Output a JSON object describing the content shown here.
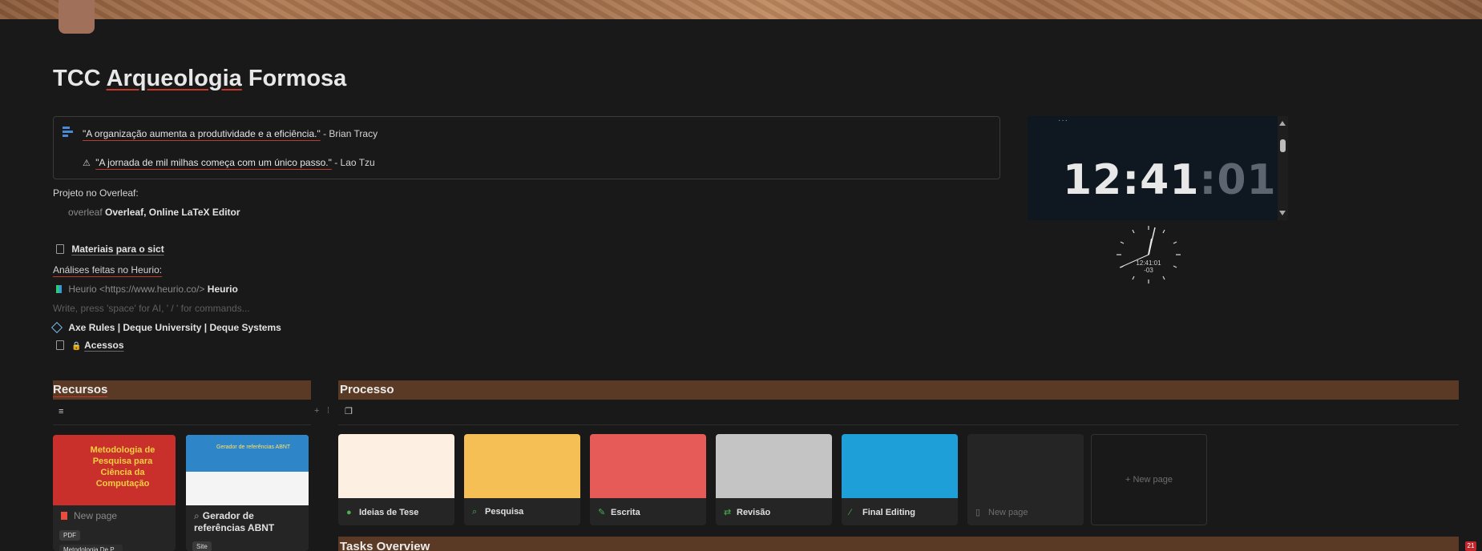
{
  "page": {
    "title_prefix": "TCC",
    "title_main": "Arqueologia",
    "title_suffix": "Formosa"
  },
  "callout": {
    "quote1": "\"A organização aumenta a produtividade e a eficiência.\"",
    "quote1_author": "- Brian Tracy",
    "quote2_icon": "⚠",
    "quote2": "\"A jornada de mil milhas começa com um único passo.\"",
    "quote2_author": "- Lao Tzu"
  },
  "blocks": {
    "overleaf_label": "Projeto no Overleaf:",
    "overleaf_prefix": "overleaf",
    "overleaf_link": "Overleaf, Online LaTeX Editor",
    "materiais": "Materiais para o sict",
    "analises_label": "Análises feitas no Heurio:",
    "heurio_prefix": "Heurio <https://www.heurio.co/>",
    "heurio_link": "Heurio",
    "placeholder": "Write, press 'space' for AI, ' / ' for commands...",
    "axe_link": "Axe Rules | Deque University | Deque Systems",
    "acessos_icon": "🔒",
    "acessos": "Acessos"
  },
  "clock": {
    "dots": "···",
    "hour_min": "12:41",
    "seconds": ":01",
    "analog_time": "12:41:01",
    "analog_offset": "-03"
  },
  "recursos": {
    "heading": "Recursos",
    "cards": [
      {
        "cover_text": "Metodologia de Pesquisa para Ciência da Computação",
        "label": "New page",
        "tag": "PDF",
        "sub": "Metodologia De P..."
      },
      {
        "cover_text": "Gerador de referências ABNT",
        "label": "Gerador de referências ABNT",
        "tag": "Site"
      }
    ]
  },
  "processo": {
    "heading": "Processo",
    "cards": [
      {
        "label": "Ideias de Tese",
        "icon": "lightbulb-icon",
        "glyph": "●",
        "color": "#fdf0e3",
        "icon_color": "#4caf50"
      },
      {
        "label": "Pesquisa",
        "icon": "search-icon",
        "glyph": "⌕",
        "color": "#f6bf55",
        "icon_color": "#4caf50"
      },
      {
        "label": "Escrita",
        "icon": "edit-icon",
        "glyph": "✎",
        "color": "#e65a58",
        "icon_color": "#4caf50"
      },
      {
        "label": "Revisão",
        "icon": "swap-icon",
        "glyph": "⇄",
        "color": "#c4c4c4",
        "icon_color": "#4caf50"
      },
      {
        "label": "Final Editing",
        "icon": "pen-icon",
        "glyph": "⁄",
        "color": "#1f9fd8",
        "icon_color": "#4caf50"
      },
      {
        "label": "New page",
        "icon": "page-icon",
        "glyph": "▯",
        "color": "#252525",
        "icon_color": "#777"
      }
    ],
    "new_page": "+ New page"
  },
  "tasks": {
    "heading": "Tasks Overview",
    "badge": "21"
  }
}
